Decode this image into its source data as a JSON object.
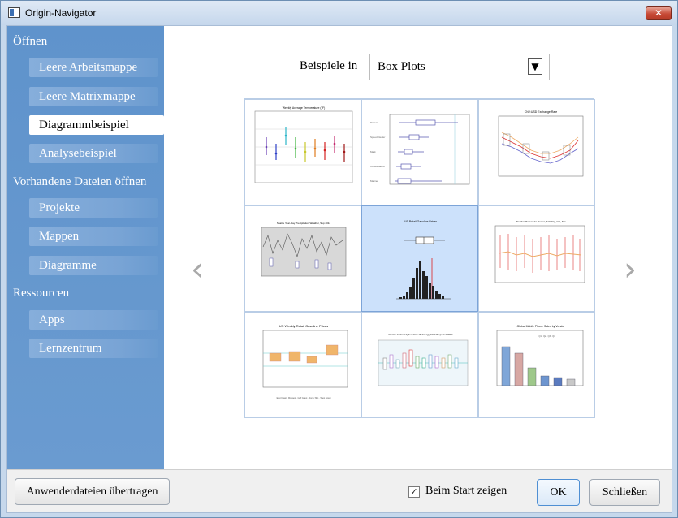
{
  "window": {
    "title": "Origin-Navigator",
    "close_label": "✕"
  },
  "sidebar": {
    "sections": [
      {
        "title": "Öffnen",
        "items": [
          "Leere Arbeitsmappe",
          "Leere Matrixmappe",
          "Diagrammbeispiel",
          "Analysebeispiel"
        ]
      },
      {
        "title": "Vorhandene Dateien öffnen",
        "items": [
          "Projekte",
          "Mappen",
          "Diagramme"
        ]
      },
      {
        "title": "Ressourcen",
        "items": [
          "Apps",
          "Lernzentrum"
        ]
      }
    ],
    "selected_item": "Diagrammbeispiel"
  },
  "main": {
    "examples_label": "Beispiele in",
    "category_select": {
      "value": "Box Plots"
    },
    "prev_icon": "chevron-left-icon",
    "next_icon": "chevron-right-icon",
    "selected_thumbnail_index": 4,
    "thumbnails": [
      {
        "caption": "Weekly Average Temperature (°F)"
      },
      {
        "caption": ""
      },
      {
        "caption": "CNY:USD Exchange Rate"
      },
      {
        "caption": "Seattle Year-Day Precipitation Weather, Sep 2012"
      },
      {
        "caption": "US Retail Gasoline Prices"
      },
      {
        "caption": "Weather Pattern for Boston, Fall Day, Oct, Nov"
      },
      {
        "caption": "US Weekly Retail Gasoline Prices"
      },
      {
        "caption": "Worlds Global Highest Day 15 Energy GDP Projected 2012"
      },
      {
        "caption": "Global Mobile Phone Sales by Vendor"
      }
    ]
  },
  "footer": {
    "transfer_button": "Anwenderdateien übertragen",
    "show_on_start_label": "Beim Start zeigen",
    "show_on_start_checked": true,
    "ok_button": "OK",
    "close_button": "Schließen"
  }
}
